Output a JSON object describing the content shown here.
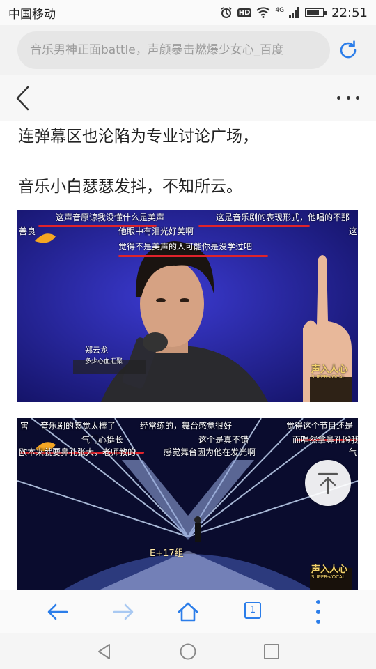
{
  "status": {
    "carrier": "中国移动",
    "network": "4G",
    "hd_label": "HD",
    "time": "22:51",
    "battery_level": 0.72
  },
  "address_bar": {
    "url_text": "音乐男神正面battle，声颜暴击燃爆少女心_百度"
  },
  "article": {
    "paragraphs": [
      "连弹幕区也沦陷为专业讨论广场，",
      "音乐小白瑟瑟发抖，不知所云。"
    ]
  },
  "image1": {
    "danmaku": [
      "这声音原谅我没懂什么是美声",
      "这是音乐剧的表现形式，他唱的不那",
      "善良",
      "这",
      "他眼中有泪光好美啊",
      "觉得不是美声的人可能你是没学过吧"
    ],
    "name_tag": "郑云龙",
    "name_sub": "多少心血汇聚",
    "logo_text": "声入人心",
    "logo_sub": "SUPER-VOCAL"
  },
  "image2": {
    "danmaku": [
      "害",
      "音乐剧的感觉太棒了",
      "经常练的，舞台感觉很好",
      "觉得这个节目还是",
      "气门心挺长",
      "这个是真不错",
      "而唱然拿鼻孔瞪我",
      "欧本来就要鼻孔张大，老师教的",
      "感觉舞台因为他在发光啊",
      "气"
    ],
    "stage_text": "E+17组",
    "logo_text": "声入人心",
    "logo_sub": "SUPER-VOCAL"
  },
  "toolbar": {
    "tab_count": "1"
  },
  "colors": {
    "accent": "#2b7de9",
    "danmaku_underline": "#e0232b"
  },
  "icons": {
    "back": "chevron-left-icon",
    "more": "more-horizontal-icon",
    "refresh": "refresh-icon",
    "totop": "arrow-up-to-top-icon",
    "nav_back": "arrow-left-icon",
    "nav_forward": "arrow-right-icon",
    "home": "home-icon",
    "menu": "more-vertical-icon"
  }
}
